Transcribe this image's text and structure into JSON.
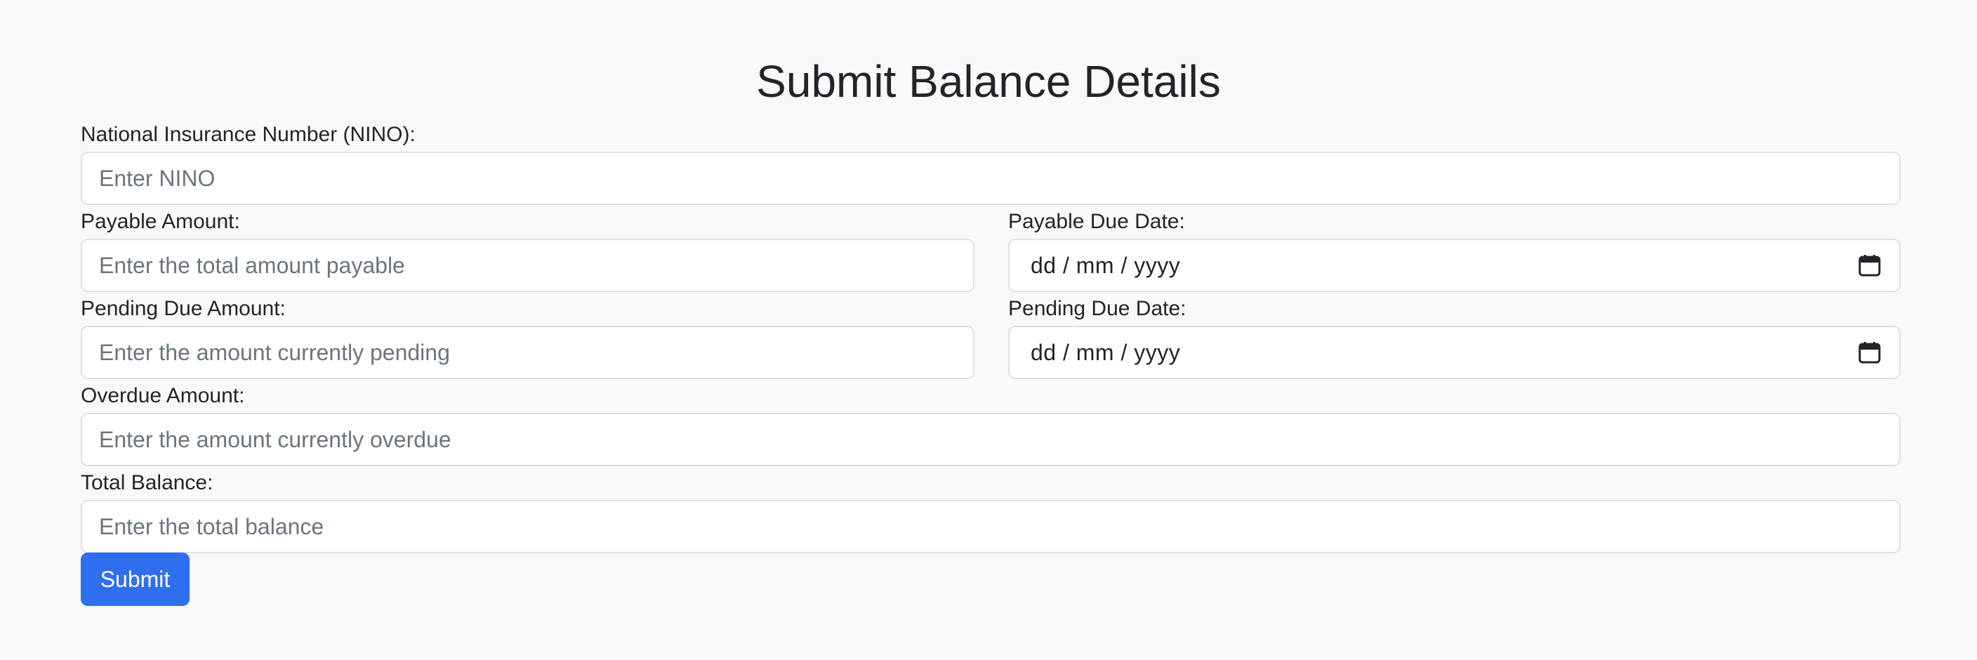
{
  "form": {
    "title": "Submit Balance Details",
    "nino": {
      "label": "National Insurance Number (NINO):",
      "placeholder": "Enter NINO",
      "value": ""
    },
    "payable_amount": {
      "label": "Payable Amount:",
      "placeholder": "Enter the total amount payable",
      "value": ""
    },
    "payable_due_date": {
      "label": "Payable Due Date:",
      "display": "dd / mm / yyyy",
      "icon": "calendar-icon"
    },
    "pending_due_amount": {
      "label": "Pending Due Amount:",
      "placeholder": "Enter the amount currently pending",
      "value": ""
    },
    "pending_due_date": {
      "label": "Pending Due Date:",
      "display": "dd / mm / yyyy",
      "icon": "calendar-icon"
    },
    "overdue_amount": {
      "label": "Overdue Amount:",
      "placeholder": "Enter the amount currently overdue",
      "value": ""
    },
    "total_balance": {
      "label": "Total Balance:",
      "placeholder": "Enter the total balance",
      "value": ""
    },
    "submit_label": "Submit"
  },
  "colors": {
    "background": "#f8f9fa",
    "primary": "#2f6fed",
    "border": "#dee2e6",
    "text": "#212529",
    "placeholder": "#6c757d"
  }
}
